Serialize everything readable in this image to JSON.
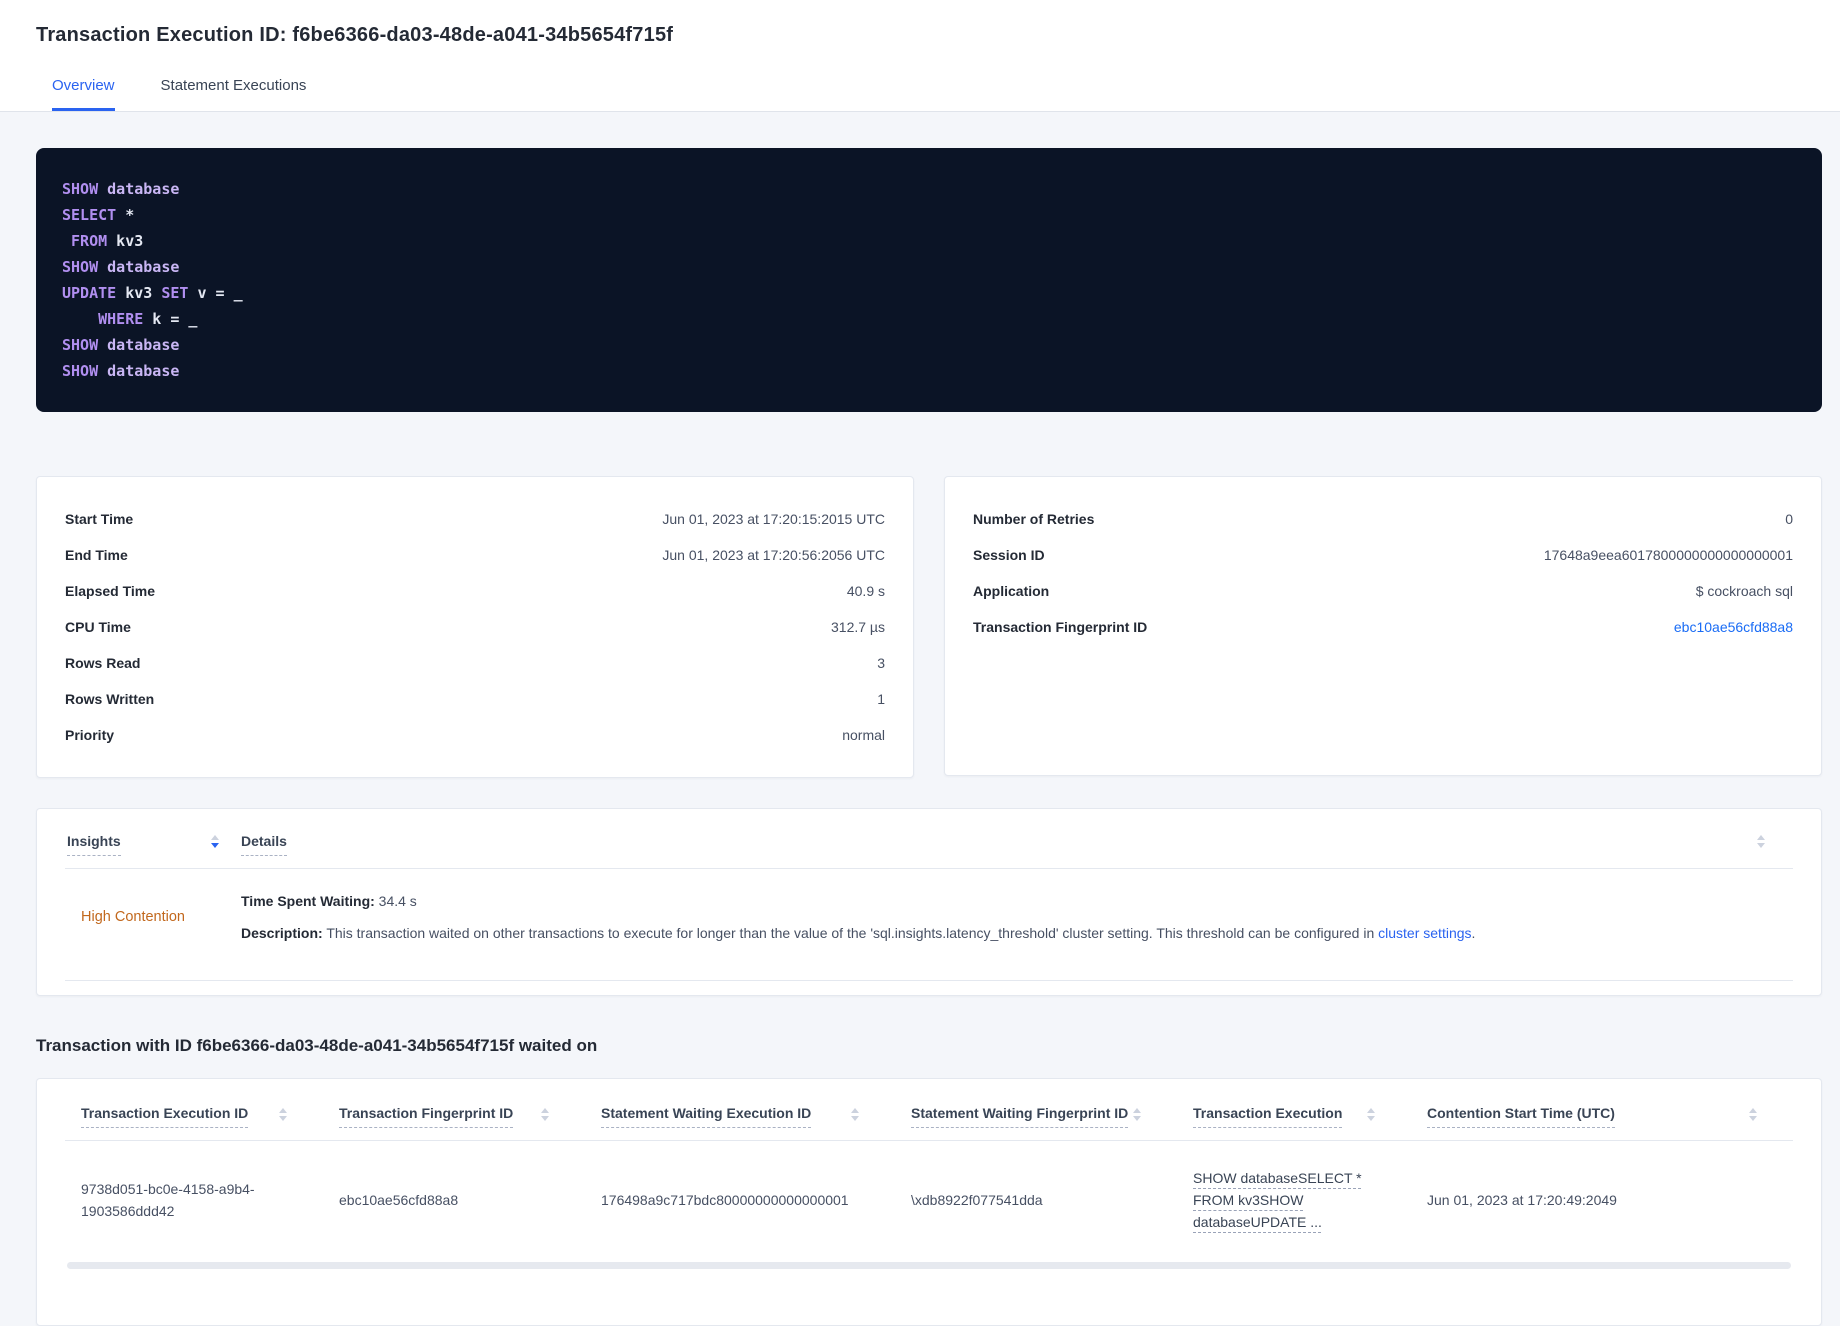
{
  "page": {
    "title": "Transaction Execution ID: f6be6366-da03-48de-a041-34b5654f715f"
  },
  "tabs": [
    {
      "label": "Overview",
      "active": true
    },
    {
      "label": "Statement Executions",
      "active": false
    }
  ],
  "sql_box": {
    "lines": [
      [
        {
          "t": "kw",
          "s": "SHOW"
        },
        {
          "t": "kw2",
          "s": " database"
        }
      ],
      [
        {
          "t": "kw",
          "s": "SELECT"
        },
        {
          "t": "id",
          "s": " *"
        }
      ],
      [
        {
          "t": "id",
          "s": " "
        },
        {
          "t": "kw",
          "s": "FROM"
        },
        {
          "t": "id",
          "s": " kv3"
        }
      ],
      [
        {
          "t": "kw",
          "s": "SHOW"
        },
        {
          "t": "kw2",
          "s": " database"
        }
      ],
      [
        {
          "t": "kw",
          "s": "UPDATE"
        },
        {
          "t": "id",
          "s": " kv3 "
        },
        {
          "t": "kw",
          "s": "SET"
        },
        {
          "t": "id",
          "s": " v = _"
        }
      ],
      [
        {
          "t": "id",
          "s": "    "
        },
        {
          "t": "kw",
          "s": "WHERE"
        },
        {
          "t": "id",
          "s": " k = _"
        }
      ],
      [
        {
          "t": "kw",
          "s": "SHOW"
        },
        {
          "t": "kw2",
          "s": " database"
        }
      ],
      [
        {
          "t": "kw",
          "s": "SHOW"
        },
        {
          "t": "kw2",
          "s": " database"
        }
      ]
    ]
  },
  "details_left": {
    "rows": [
      {
        "label": "Start Time",
        "value": "Jun 01, 2023 at 17:20:15:2015 UTC"
      },
      {
        "label": "End Time",
        "value": "Jun 01, 2023 at 17:20:56:2056 UTC"
      },
      {
        "label": "Elapsed Time",
        "value": "40.9 s"
      },
      {
        "label": "CPU Time",
        "value": "312.7 µs"
      },
      {
        "label": "Rows Read",
        "value": "3"
      },
      {
        "label": "Rows Written",
        "value": "1"
      },
      {
        "label": "Priority",
        "value": "normal"
      }
    ]
  },
  "details_right": {
    "rows": [
      {
        "label": "Number of Retries",
        "value": "0"
      },
      {
        "label": "Session ID",
        "value": "17648a9eea6017800000000000000001"
      },
      {
        "label": "Application",
        "value": "$ cockroach sql"
      },
      {
        "label": "Transaction Fingerprint ID",
        "value": "ebc10ae56cfd88a8",
        "link": true
      }
    ]
  },
  "insights": {
    "header": {
      "col1": "Insights",
      "col2": "Details"
    },
    "rows": [
      {
        "insight": "High Contention",
        "waiting_label": "Time Spent Waiting:",
        "waiting_value": " 34.4 s",
        "description_label": "Description:",
        "description_text": " This transaction waited on other transactions to execute for longer than the value of the 'sql.insights.latency_threshold' cluster setting. This threshold can be configured in ",
        "description_link": "cluster settings",
        "description_suffix": "."
      }
    ]
  },
  "waited_on": {
    "heading": "Transaction with ID f6be6366-da03-48de-a041-34b5654f715f waited on",
    "columns": [
      "Transaction Execution ID",
      "Transaction Fingerprint ID",
      "Statement Waiting Execution ID",
      "Statement Waiting Fingerprint ID",
      "Transaction Execution",
      "Contention Start Time (UTC)"
    ],
    "link_col": 4,
    "rows": [
      [
        "9738d051-bc0e-4158-a9b4-1903586ddd42",
        "ebc10ae56cfd88a8",
        "176498a9c717bdc80000000000000001",
        "\\xdb8922f077541dda",
        "SHOW databaseSELECT * FROM kv3SHOW databaseUPDATE ...",
        "Jun 01, 2023 at 17:20:49:2049"
      ]
    ]
  },
  "colors": {
    "accent_blue": "#2a63f0",
    "link_blue": "#1a6cf5",
    "warning_orange": "#c2681d",
    "code_background": "#0b1426",
    "code_keyword": "#b18ff0",
    "code_keyword_secondary": "#c9b6f4",
    "code_identifier": "#e4e8f2"
  }
}
